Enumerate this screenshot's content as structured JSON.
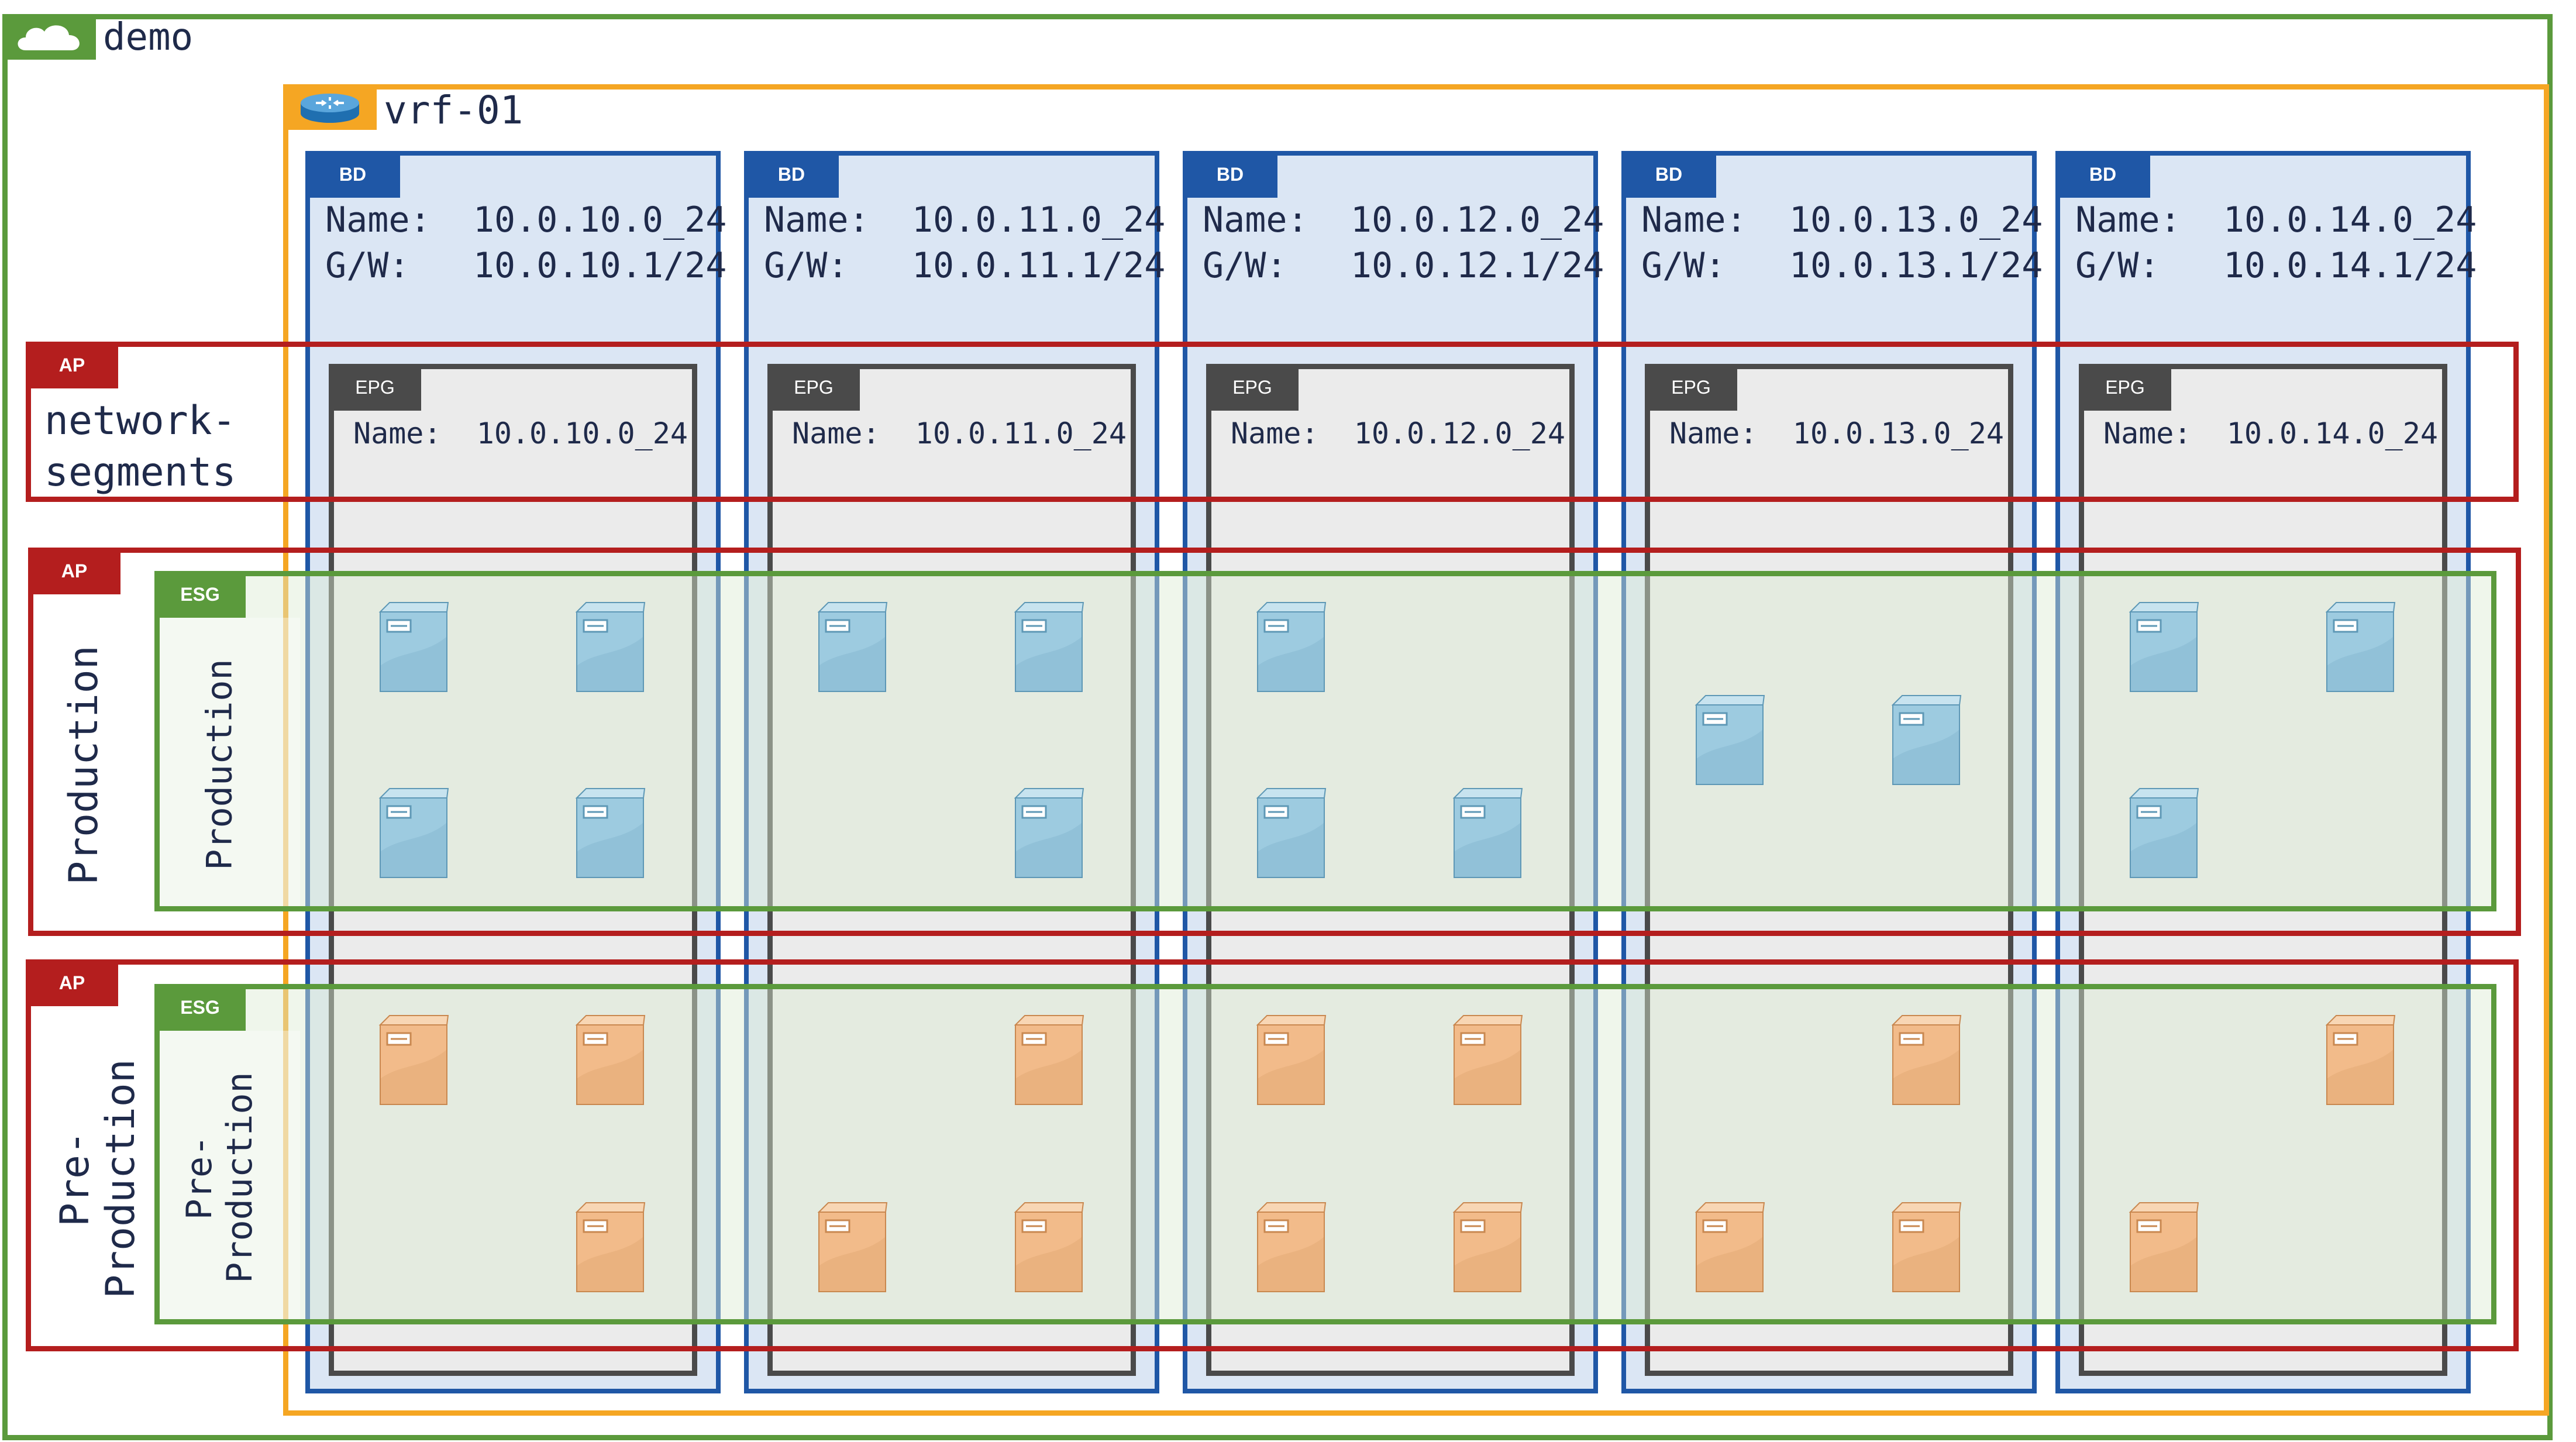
{
  "colors": {
    "tenant": "#5b9a3c",
    "vrf": "#f5a623",
    "bd": "#1f57a6",
    "bd_fill": "#dbe6f4",
    "epg": "#4a4a4a",
    "epg_fill": "#ebebeb",
    "ap": "#b41e1e",
    "esg": "#5b9a3c",
    "esg_fill": "#e6efe0",
    "prod_server": "#8fc3dc",
    "preprod_server": "#f0b27a"
  },
  "tenant": {
    "name": "demo",
    "icon": "cloud-icon"
  },
  "vrf": {
    "name": "vrf-01",
    "icon": "router-icon"
  },
  "bridge_domains": [
    {
      "tag": "BD",
      "name_line": "Name:  10.0.10.0_24",
      "gw_line": "G/W:   10.0.10.1/24",
      "epg_tag": "EPG",
      "epg_name": "Name:  10.0.10.0_24"
    },
    {
      "tag": "BD",
      "name_line": "Name:  10.0.11.0_24",
      "gw_line": "G/W:   10.0.11.1/24",
      "epg_tag": "EPG",
      "epg_name": "Name:  10.0.11.0_24"
    },
    {
      "tag": "BD",
      "name_line": "Name:  10.0.12.0_24",
      "gw_line": "G/W:   10.0.12.1/24",
      "epg_tag": "EPG",
      "epg_name": "Name:  10.0.12.0_24"
    },
    {
      "tag": "BD",
      "name_line": "Name:  10.0.13.0_24",
      "gw_line": "G/W:   10.0.13.1/24",
      "epg_tag": "EPG",
      "epg_name": "Name:  10.0.13.0_24"
    },
    {
      "tag": "BD",
      "name_line": "Name:  10.0.14.0_24",
      "gw_line": "G/W:   10.0.14.1/24",
      "epg_tag": "EPG",
      "epg_name": "Name:  10.0.14.0_24"
    }
  ],
  "app_profiles": [
    {
      "tag": "AP",
      "name": "network-\nsegments"
    },
    {
      "tag": "AP",
      "name": "Production",
      "esg_tag": "ESG",
      "esg_name": "Production"
    },
    {
      "tag": "AP",
      "name": "Pre-\nProduction",
      "esg_tag": "ESG",
      "esg_name": "Pre-\nProduction"
    }
  ],
  "servers": {
    "production": [
      [
        [
          0,
          0
        ],
        [
          1,
          0
        ],
        [
          0,
          1
        ],
        [
          1,
          1
        ]
      ],
      [
        [
          0,
          0
        ],
        [
          1,
          0
        ],
        [
          1,
          1
        ]
      ],
      [
        [
          0,
          0
        ],
        [
          0,
          1
        ],
        [
          1,
          1
        ]
      ],
      [
        [
          0,
          0.5
        ],
        [
          1,
          0.5
        ]
      ],
      [
        [
          0,
          0
        ],
        [
          1,
          0
        ],
        [
          0,
          1
        ]
      ]
    ],
    "preproduction": [
      [
        [
          0,
          0
        ],
        [
          1,
          0
        ],
        [
          1,
          1
        ]
      ],
      [
        [
          1,
          0
        ],
        [
          0,
          1
        ],
        [
          1,
          1
        ]
      ],
      [
        [
          0,
          0
        ],
        [
          1,
          0
        ],
        [
          0,
          1
        ],
        [
          1,
          1
        ]
      ],
      [
        [
          1,
          0
        ],
        [
          0,
          1
        ],
        [
          1,
          1
        ]
      ],
      [
        [
          1,
          0
        ],
        [
          0,
          1
        ]
      ]
    ]
  }
}
